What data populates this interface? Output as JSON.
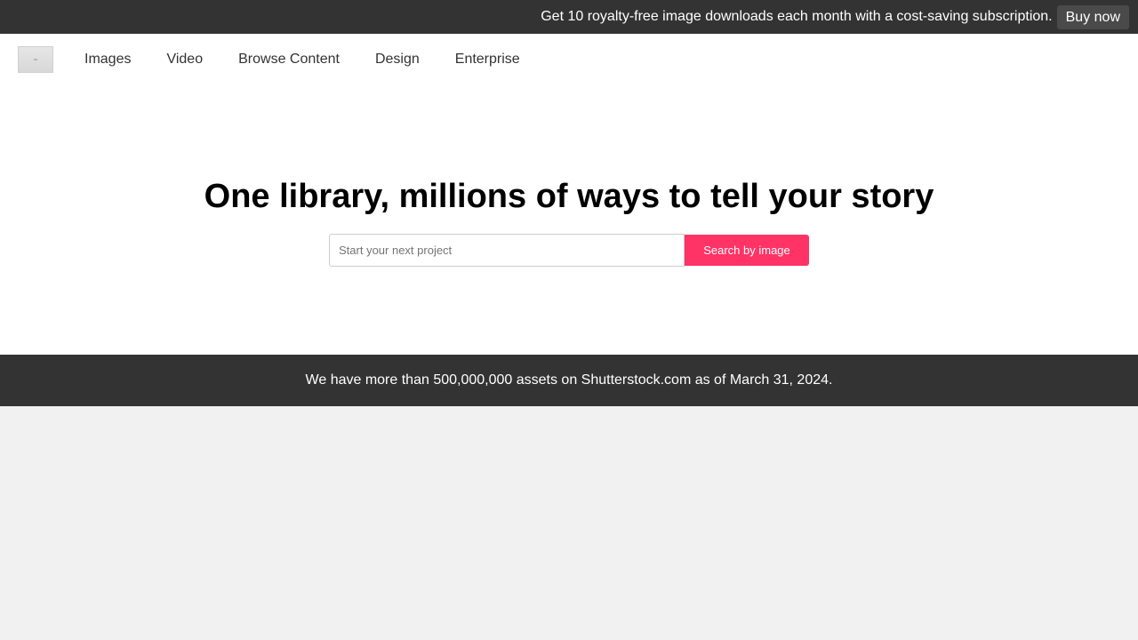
{
  "promo": {
    "text": "Get 10 royalty-free image downloads each month with a cost-saving subscription.",
    "button_label": "Buy now"
  },
  "nav": {
    "items": [
      {
        "label": "Images"
      },
      {
        "label": "Video"
      },
      {
        "label": "Browse Content"
      },
      {
        "label": "Design"
      },
      {
        "label": "Enterprise"
      }
    ]
  },
  "hero": {
    "title": "One library, millions of ways to tell your story",
    "search_placeholder": "Start your next project",
    "search_value": "",
    "search_button_label": "Search by image"
  },
  "stats": {
    "text": "We have more than 500,000,000 assets on Shutterstock.com as of March 31, 2024."
  },
  "colors": {
    "promo_bg": "#333333",
    "accent": "#ff3366",
    "page_bg": "#f1f1f1"
  }
}
